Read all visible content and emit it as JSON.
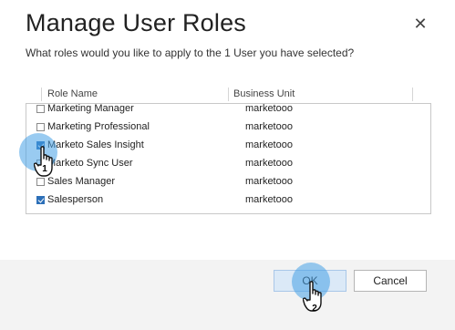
{
  "dialog": {
    "title": "Manage User Roles",
    "subtitle": "What roles would you like to apply to the 1 User you have selected?",
    "close_glyph": "✕"
  },
  "table": {
    "columns": [
      "Role Name",
      "Business Unit"
    ],
    "rows": [
      {
        "name": "Marketing Manager",
        "unit": "marketooo",
        "checked": false
      },
      {
        "name": "Marketing Professional",
        "unit": "marketooo",
        "checked": false
      },
      {
        "name": "Marketo Sales Insight",
        "unit": "marketooo",
        "checked": true
      },
      {
        "name": "Marketo Sync User",
        "unit": "marketooo",
        "checked": false
      },
      {
        "name": "Sales Manager",
        "unit": "marketooo",
        "checked": false
      },
      {
        "name": "Salesperson",
        "unit": "marketooo",
        "checked": true
      }
    ]
  },
  "footer": {
    "ok_label": "OK",
    "cancel_label": "Cancel"
  },
  "annotations": {
    "step1": "1",
    "step2": "2"
  },
  "colors": {
    "checked": "#2c6fb8",
    "halo": "#46a0e6",
    "ok_bg": "#dbe9f7"
  }
}
